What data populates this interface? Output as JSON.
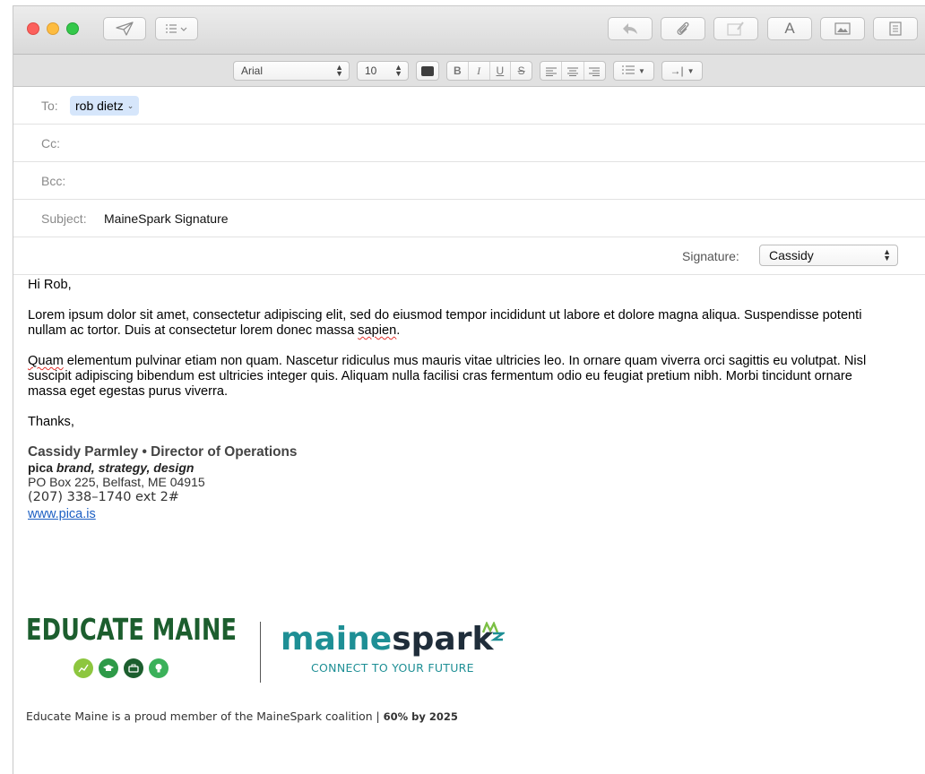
{
  "toolbar": {
    "icons": [
      "send-icon",
      "header-fields-icon",
      "reply-icon",
      "attach-icon",
      "annotate-icon",
      "fonts-icon",
      "photo-browser-icon",
      "format-icon"
    ],
    "format_icon_label": "A"
  },
  "formatbar": {
    "font": "Arial",
    "size": "10",
    "bold": "B",
    "italic": "I",
    "underline": "U",
    "strike": "S"
  },
  "fields": {
    "to_label": "To:",
    "to_recipient": "rob dietz",
    "cc_label": "Cc:",
    "bcc_label": "Bcc:",
    "subject_label": "Subject:",
    "subject_value": "MaineSpark Signature",
    "signature_label": "Signature:",
    "signature_value": "Cassidy"
  },
  "body": {
    "greeting": "Hi Rob,",
    "para1_a": "Lorem ipsum dolor sit amet, consectetur adipiscing elit, sed do eiusmod tempor incididunt ut labore et dolore magna aliqua. Suspendisse potenti nullam ac tortor. Duis at consectetur lorem donec massa ",
    "para1_misspelled": "sapien",
    "para1_b": ".",
    "para2_misspelled": "Quam",
    "para2_a": " elementum pulvinar etiam non quam. Nascetur ridiculus mus mauris vitae ultricies leo. In ornare quam viverra orci sagittis eu volutpat. Nisl suscipit adipiscing bibendum est ultricies integer quis. Aliquam nulla facilisi cras fermentum odio eu feugiat pretium nibh. Morbi tincidunt ornare massa eget egestas purus viverra.",
    "closing": "Thanks,"
  },
  "signature": {
    "name_line": "Cassidy Parmley • Director of Operations",
    "company": "pica",
    "tagline": "brand, strategy, design",
    "address": "PO Box 225, Belfast, ME 04915",
    "phone": "(207) 338–1740 ext 2#",
    "website": "www.pica.is",
    "educate_logo": "EDUCATE MAINE",
    "mainespark_maine": "maine",
    "mainespark_spark": "spark",
    "mainespark_tagline": "CONNECT TO YOUR FUTURE",
    "footer_text": "Educate Maine is a proud member of the MaineSpark coalition |",
    "footer_bold": "60% by 2025"
  },
  "colors": {
    "educate_green": "#1c5e2e",
    "mainespark_teal": "#1e8f95",
    "link_blue": "#1c5fc3",
    "token_bg": "#d6e6fb"
  }
}
